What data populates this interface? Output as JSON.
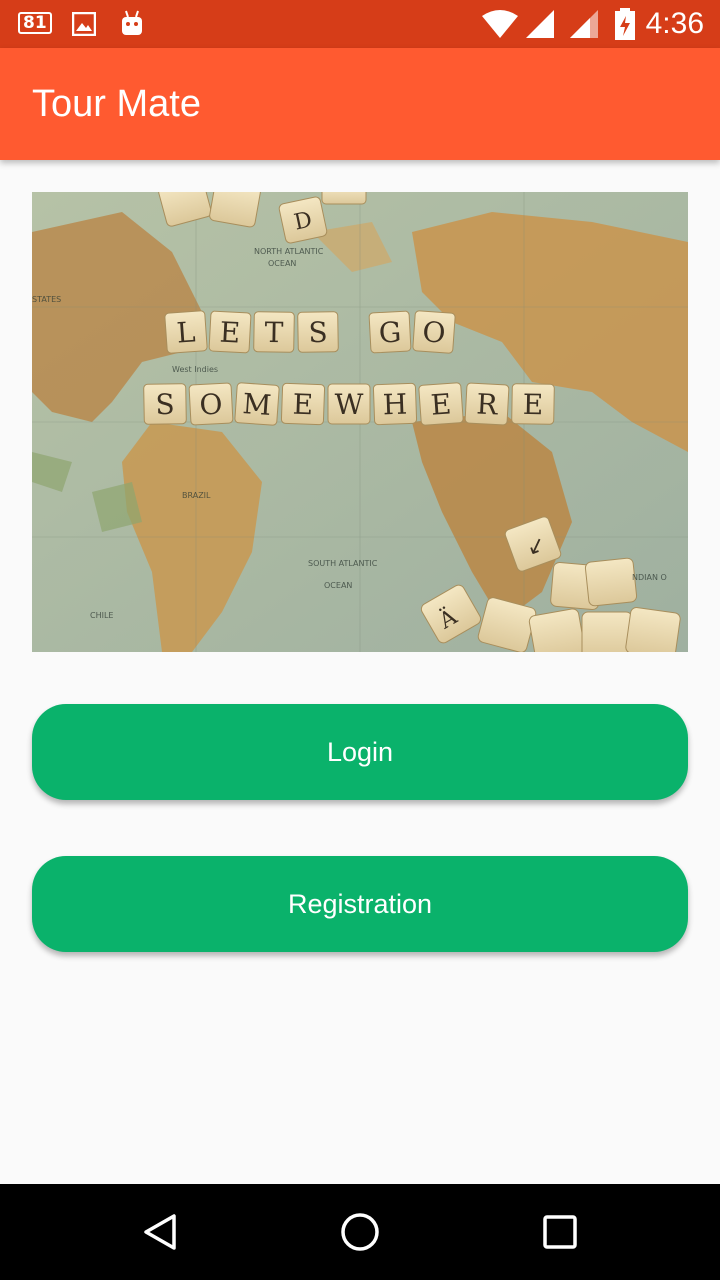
{
  "status_bar": {
    "notification_count": "81",
    "time": "4:36",
    "icons": [
      "notification-count-icon",
      "image-icon",
      "android-icon",
      "wifi-icon",
      "signal-icon",
      "signal-icon",
      "battery-charging-icon"
    ]
  },
  "app_bar": {
    "title": "Tour Mate",
    "color": "#ff5a30"
  },
  "hero_image": {
    "description_icon": "map-scrabble-image",
    "tile_lines": [
      [
        "L",
        "E",
        "T",
        "S",
        "G",
        "O"
      ],
      [
        "S",
        "O",
        "M",
        "E",
        "W",
        "H",
        "E",
        "R",
        "E"
      ]
    ]
  },
  "buttons": {
    "login_label": "Login",
    "registration_label": "Registration",
    "color": "#0ab26b"
  },
  "nav_bar": {
    "icons": [
      "back-icon",
      "home-icon",
      "recents-icon"
    ]
  }
}
